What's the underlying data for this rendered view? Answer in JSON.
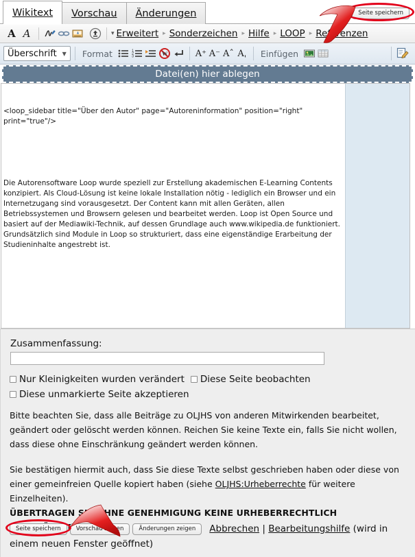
{
  "tabs": [
    {
      "label": "Wikitext",
      "active": true
    },
    {
      "label": "Vorschau",
      "active": false
    },
    {
      "label": "Änderungen",
      "active": false
    }
  ],
  "top_save_button": "Seite speichern",
  "toolbar_primary": {
    "icons": [
      {
        "name": "bold-icon",
        "glyph": "A"
      },
      {
        "name": "italic-icon",
        "glyph": "A"
      },
      {
        "name": "signature-icon",
        "glyph": "signature"
      },
      {
        "name": "link-icon",
        "glyph": "chain"
      },
      {
        "name": "reference-icon",
        "glyph": "reference"
      },
      {
        "name": "upload-icon",
        "glyph": "upload"
      }
    ],
    "menus": [
      {
        "label": "Erweitert",
        "caret": "▾"
      },
      {
        "label": "Sonderzeichen",
        "caret": "▸"
      },
      {
        "label": "Hilfe",
        "caret": "▸"
      },
      {
        "label": "LOOP",
        "caret": "▸"
      },
      {
        "label": "Referenzen",
        "caret": "▸"
      }
    ]
  },
  "toolbar_secondary": {
    "heading_select": "Überschrift",
    "format_label": "Format",
    "format_icons": [
      {
        "name": "bullet-list-icon"
      },
      {
        "name": "numbered-list-icon"
      },
      {
        "name": "indent-icon"
      },
      {
        "name": "no-wiki-icon"
      },
      {
        "name": "line-break-icon"
      }
    ],
    "size_icons": [
      {
        "name": "font-bigger-icon",
        "glyph": "A⁺"
      },
      {
        "name": "font-smaller-icon",
        "glyph": "A⁻"
      },
      {
        "name": "superscript-icon",
        "glyph": "A˄"
      },
      {
        "name": "subscript-icon",
        "glyph": "A˅"
      }
    ],
    "insert_label": "Einfügen",
    "insert_icons": [
      {
        "name": "insert-image-icon"
      },
      {
        "name": "insert-table-icon"
      }
    ],
    "right_icon": {
      "name": "edit-page-icon"
    }
  },
  "dropzone_label": "Datei(en) hier ablegen",
  "editor": {
    "line1": "<loop_sidebar title=\"Über den Autor\" page=\"Autoreninformation\" position=\"right\" print=\"true\"/>",
    "paragraph": "Die Autorensoftware Loop wurde speziell zur Erstellung akademischen E-Learning Contents konzipiert. Als Cloud-Lösung ist keine lokale Installation nötig - lediglich ein Browser und ein Internetzugang sind vorausgesetzt. Der Content kann mit allen Geräten, allen Betriebssystemen und Browsern gelesen und bearbeitet werden. Loop ist Open Source und basiert auf der Mediawiki-Technik, auf dessen Grundlage auch www.wikipedia.de funktioniert. Grundsätzlich sind Module in Loop so strukturiert, dass eine eigenständige Erarbeitung der Studieninhalte angestrebt ist."
  },
  "form": {
    "summary_label": "Zusammenfassung:",
    "summary_value": "",
    "summary_placeholder": "",
    "checkboxes": [
      {
        "label": "Nur Kleinigkeiten wurden verändert",
        "checked": false
      },
      {
        "label": "Diese Seite beobachten",
        "checked": false
      },
      {
        "label": "Diese unmarkierte Seite akzeptieren",
        "checked": false
      }
    ],
    "legal_p1": "Bitte beachten Sie, dass alle Beiträge zu OLJHS von anderen Mitwirkenden bearbeitet, geändert oder gelöscht werden können. Reichen Sie keine Texte ein, falls Sie nicht wollen, dass diese ohne Einschränkung geändert werden können.",
    "legal_p2_pre": "Sie bestätigen hiermit auch, dass Sie diese Texte selbst geschrieben haben oder diese von einer gemeinfreien Quelle kopiert haben (siehe ",
    "legal_p2_link": "OLJHS:Urheberrechte",
    "legal_p2_post": " für weitere Einzelheiten).",
    "legal_caps": "ÜBERTRAGEN SIE OHNE GENEHMIGUNG KEINE URHEBERRECHTLICH GESCHÜTZTEN INHALTE!"
  },
  "buttons": {
    "save": "Seite speichern",
    "preview": "Vorschau zeigen",
    "diff": "Änderungen zeigen",
    "cancel": "Abbrechen",
    "separator": "|",
    "help": "Bearbeitungshilfe",
    "help_note": "(wird in einem neuen Fenster geöffnet)"
  },
  "colors": {
    "annotation_red": "#e2001a",
    "dropzone_bg": "#637b92",
    "side_panel_bg": "#dde9f2",
    "form_bg": "#eeeeee"
  }
}
